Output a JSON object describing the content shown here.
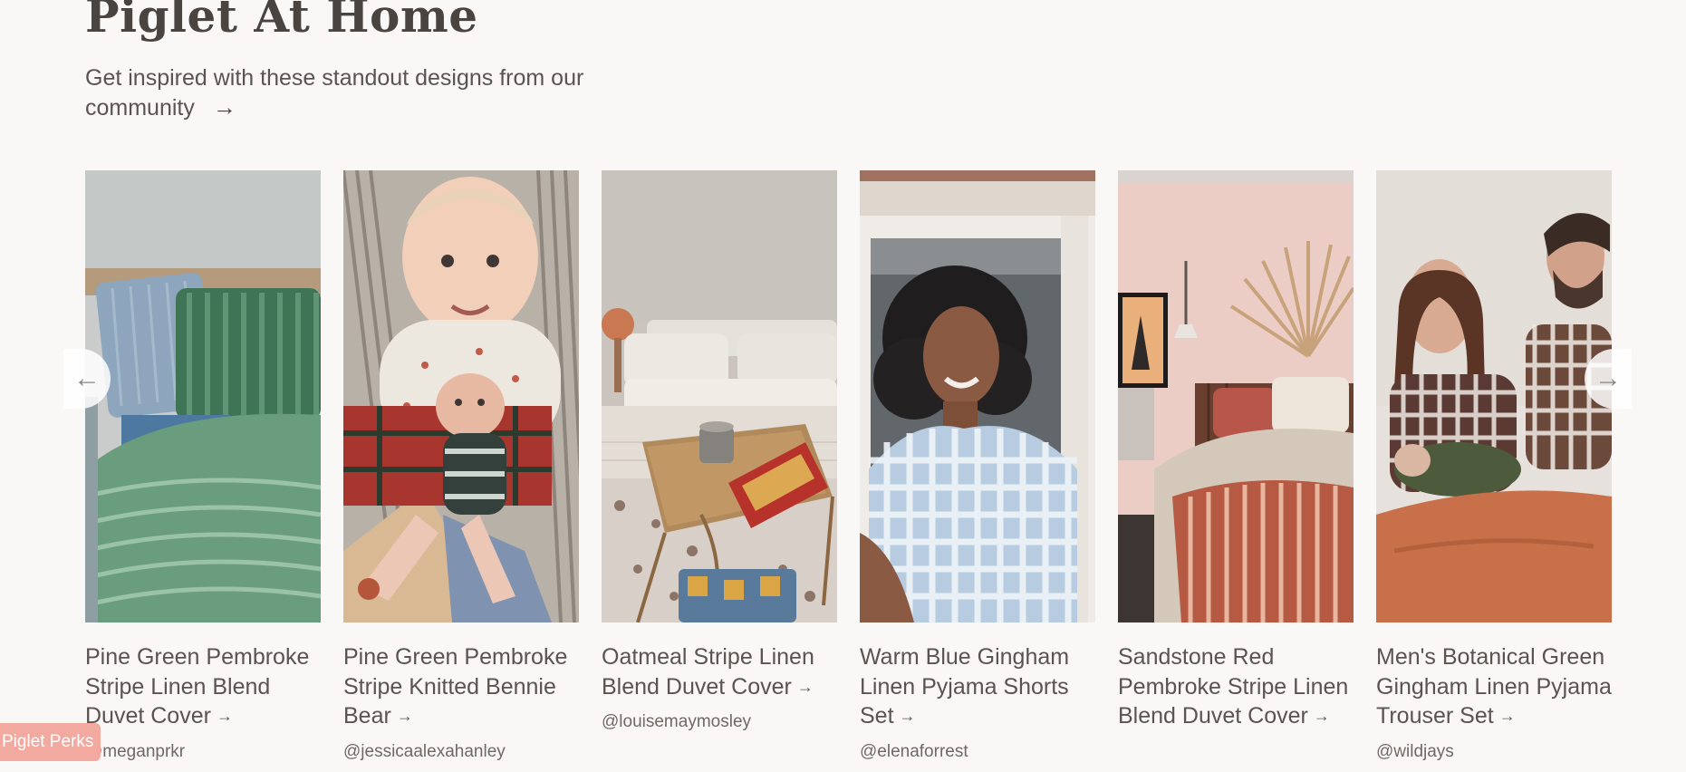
{
  "section": {
    "title": "Piglet At Home",
    "subtitle": "Get inspired with these standout designs from our community",
    "subtitle_arrow": "→"
  },
  "carousel": {
    "prev_icon": "←",
    "next_icon": "→",
    "cards": [
      {
        "title": "Pine Green Pembroke Stripe Linen Blend Duvet Cover",
        "arrow": "→",
        "handle": "@meganprkr",
        "image": "green-stripe-bedding-photo"
      },
      {
        "title": "Pine Green Pembroke Stripe Knitted Bennie Bear",
        "arrow": "→",
        "handle": "@jessicaalexahanley",
        "image": "baby-with-knitted-bear-photo"
      },
      {
        "title": "Oatmeal Stripe Linen Blend Duvet Cover",
        "arrow": "→",
        "handle": "@louisemaymosley",
        "image": "oatmeal-bedding-breakfast-tray-photo"
      },
      {
        "title": "Warm Blue Gingham Linen Pyjama Shorts Set",
        "arrow": "→",
        "handle": "@elenaforrest",
        "image": "woman-blue-gingham-pyjamas-photo"
      },
      {
        "title": "Sandstone Red Pembroke Stripe Linen Blend Duvet Cover",
        "arrow": "→",
        "handle": "",
        "image": "sandstone-red-bedroom-photo"
      },
      {
        "title": "Men's Botanical Green Gingham Linen Pyjama Trouser Set",
        "arrow": "→",
        "handle": "@wildjays",
        "image": "family-gingham-pyjamas-photo"
      }
    ]
  },
  "perks_button": {
    "label": "Piglet Perks"
  },
  "colors": {
    "background": "#faf8f6",
    "text": "#4a4441",
    "perks": "#f2a99f"
  }
}
